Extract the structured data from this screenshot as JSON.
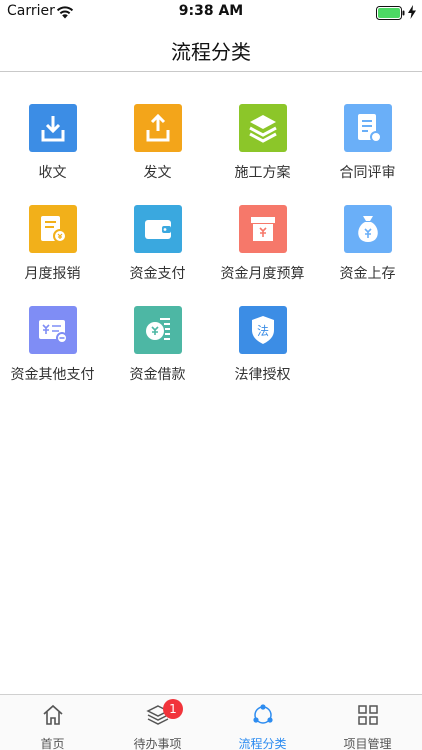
{
  "status_bar": {
    "carrier": "Carrier",
    "time": "9:38 AM"
  },
  "nav": {
    "title": "流程分类"
  },
  "tiles": [
    {
      "label": "收文",
      "icon": "inbox-download-icon",
      "color": "#3c8de5"
    },
    {
      "label": "发文",
      "icon": "outbox-upload-icon",
      "color": "#f3a51a"
    },
    {
      "label": "施工方案",
      "icon": "layers-icon",
      "color": "#8cc629"
    },
    {
      "label": "合同评审",
      "icon": "contract-review-icon",
      "color": "#6aaff8"
    },
    {
      "label": "月度报销",
      "icon": "reimbursement-icon",
      "color": "#f2b01a"
    },
    {
      "label": "资金支付",
      "icon": "wallet-icon",
      "color": "#3aa8df"
    },
    {
      "label": "资金月度预算",
      "icon": "budget-box-icon",
      "color": "#f6786a"
    },
    {
      "label": "资金上存",
      "icon": "money-bag-icon",
      "color": "#6aaff8"
    },
    {
      "label": "资金其他支付",
      "icon": "yen-card-icon",
      "color": "#7f8df5"
    },
    {
      "label": "资金借款",
      "icon": "yen-ledger-icon",
      "color": "#4db7a4"
    },
    {
      "label": "法律授权",
      "icon": "law-shield-icon",
      "color": "#3c8de5"
    }
  ],
  "tabs": [
    {
      "label": "首页",
      "icon": "home-icon",
      "active": false
    },
    {
      "label": "待办事项",
      "icon": "layers-outline-icon",
      "active": false,
      "badge": "1"
    },
    {
      "label": "流程分类",
      "icon": "share-circle-icon",
      "active": true
    },
    {
      "label": "项目管理",
      "icon": "grid-icon",
      "active": false
    }
  ],
  "colors": {
    "accent": "#2d8cf0",
    "badge": "#f1343b",
    "battery": "#4cd964"
  }
}
